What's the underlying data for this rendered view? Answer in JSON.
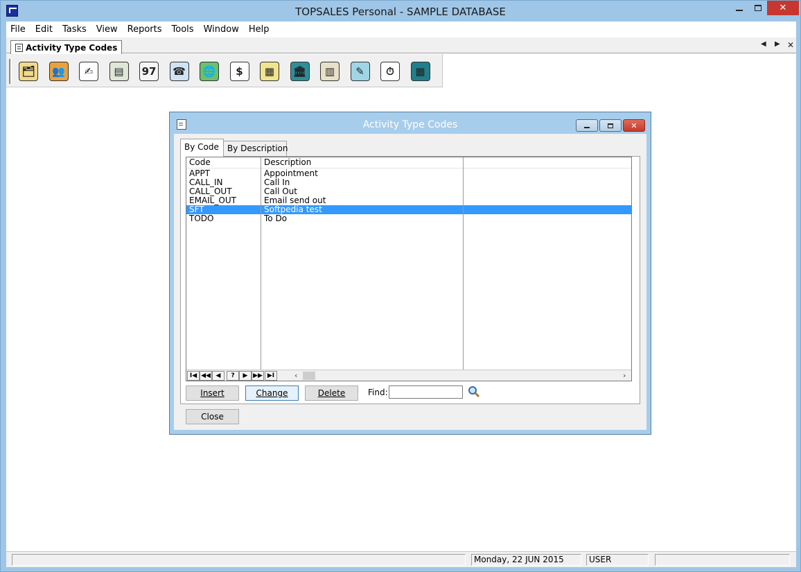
{
  "app": {
    "title": "TOPSALES Personal - SAMPLE DATABASE"
  },
  "menu": [
    "File",
    "Edit",
    "Tasks",
    "View",
    "Reports",
    "Tools",
    "Window",
    "Help"
  ],
  "doc_tab": {
    "label": "Activity Type Codes"
  },
  "toolbar": {
    "buttons": [
      {
        "icon": "contacts-folder-icon",
        "glyph": "🗂"
      },
      {
        "icon": "people-icon",
        "glyph": "👥"
      },
      {
        "icon": "sign-document-icon",
        "glyph": "✍"
      },
      {
        "icon": "forms-icon",
        "glyph": "▤"
      },
      {
        "icon": "calendar-97-icon",
        "glyph": "97"
      },
      {
        "icon": "telephone-icon",
        "glyph": "☎"
      },
      {
        "icon": "globe-computer-icon",
        "glyph": "🌐"
      },
      {
        "icon": "dollar-document-icon",
        "glyph": "$"
      },
      {
        "icon": "cash-register-icon",
        "glyph": "▦"
      },
      {
        "icon": "bank-icon",
        "glyph": "🏛"
      },
      {
        "icon": "shop-display-icon",
        "glyph": "▥"
      },
      {
        "icon": "desk-lamp-icon",
        "glyph": "✎"
      },
      {
        "icon": "stopwatch-icon",
        "glyph": "⏱"
      },
      {
        "icon": "calculator-icon",
        "glyph": "▦"
      }
    ]
  },
  "dialog": {
    "title": "Activity Type Codes",
    "tabs": [
      "By Code",
      "By Description"
    ],
    "columns": [
      "Code",
      "Description"
    ],
    "rows": [
      {
        "code": "APPT",
        "description": "Appointment"
      },
      {
        "code": "CALL_IN",
        "description": "Call In"
      },
      {
        "code": "CALL_OUT",
        "description": "Call Out"
      },
      {
        "code": "EMAIL_OUT",
        "description": "Email send out"
      },
      {
        "code": "SFT",
        "description": "Softpedia test",
        "selected": true
      },
      {
        "code": "TODO",
        "description": "To Do"
      }
    ],
    "nav": [
      "I◀",
      "◀◀",
      "◀",
      "?",
      "▶",
      "▶▶",
      "▶I"
    ],
    "insert_label": "Insert",
    "change_label": "Change",
    "delete_label": "Delete",
    "find_label": "Find:",
    "find_value": "",
    "close_label": "Close"
  },
  "status": {
    "date": "Monday, 22 JUN 2015",
    "user": "USER"
  },
  "colors": {
    "selection": "#3399ff",
    "frame": "#9fc6e7",
    "close": "#c7372f"
  }
}
